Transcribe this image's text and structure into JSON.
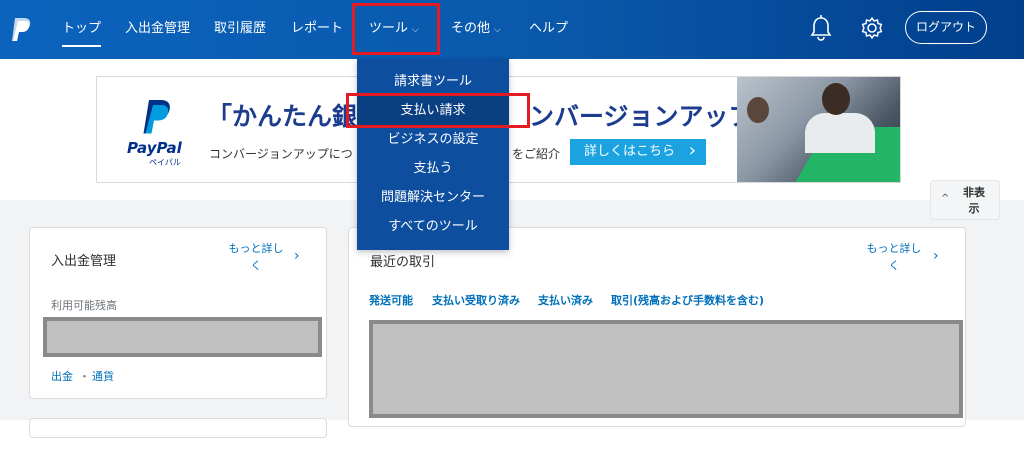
{
  "nav": {
    "items": [
      {
        "label": "トップ"
      },
      {
        "label": "入出金管理"
      },
      {
        "label": "取引履歴"
      },
      {
        "label": "レポート"
      },
      {
        "label": "ツール"
      },
      {
        "label": "その他"
      },
      {
        "label": "ヘルプ"
      }
    ],
    "caret": "⌵",
    "logout_label": "ログアウト"
  },
  "tools_menu": {
    "items": [
      {
        "label": "請求書ツール"
      },
      {
        "label": "支払い請求"
      },
      {
        "label": "ビジネスの設定"
      },
      {
        "label": "支払う"
      },
      {
        "label": "問題解決センター"
      },
      {
        "label": "すべてのツール"
      }
    ]
  },
  "banner": {
    "brand": "PayPal",
    "brand_kana": "ペイパル",
    "headline_start": "「かんたん銀",
    "headline_end": "ンバージョンアップ!",
    "sub_start": "コンバージョンアップにつ",
    "sub_end": "をご紹介",
    "cta_label": "詳しくはこちら"
  },
  "hide_button": {
    "label": "非表示"
  },
  "balance_card": {
    "title": "入出金管理",
    "more_label": "もっと詳し く",
    "available_label": "利用可能残高",
    "withdraw_label": "出金",
    "separator": "・",
    "currency_label": "通貨"
  },
  "recent_card": {
    "title": "最近の取引",
    "more_label": "もっと詳し く",
    "tabs": [
      {
        "label": "発送可能"
      },
      {
        "label": "支払い受取り済み"
      },
      {
        "label": "支払い済み"
      },
      {
        "label": "取引(残高および手数料を含む)"
      }
    ]
  },
  "colors": {
    "nav_blue": "#0b63bd",
    "dropdown_blue": "#0d4e9e",
    "highlight_red": "#e51b24",
    "link_blue": "#0070ba"
  },
  "icons": [
    "paypal-logo-icon",
    "bell-icon",
    "gear-icon",
    "chevron-right-icon",
    "chevron-up-icon"
  ]
}
